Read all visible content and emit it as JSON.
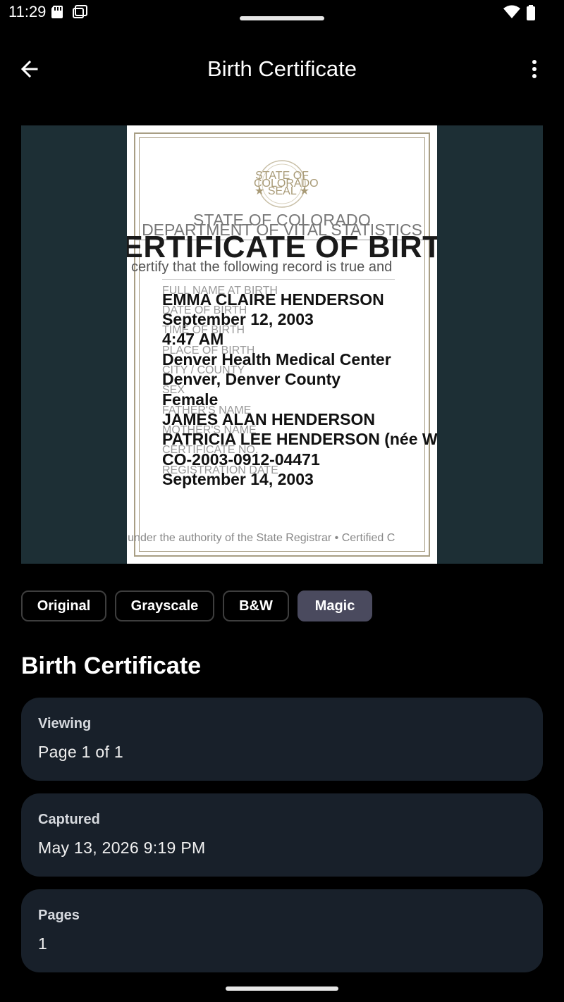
{
  "status_bar": {
    "time": "11:29",
    "icons": [
      "sd-card-icon",
      "screenshot-icon",
      "wifi-icon",
      "battery-icon"
    ]
  },
  "app_bar": {
    "title": "Birth Certificate",
    "back_icon": "arrow-left-icon",
    "menu_icon": "more-vert-icon"
  },
  "preview": {
    "seal_lines": [
      "STATE OF",
      "COLORADO",
      "★ SEAL ★"
    ],
    "state": "STATE OF COLORADO",
    "department": "DEPARTMENT OF VITAL STATISTICS",
    "title": "CERTIFICATE OF BIRTH",
    "certify_text": "certify that the following record is true and",
    "fields": [
      {
        "label": "FULL NAME AT BIRTH",
        "value": "EMMA CLAIRE HENDERSON"
      },
      {
        "label": "DATE OF BIRTH",
        "value": "September 12, 2003"
      },
      {
        "label": "TIME OF BIRTH",
        "value": "4:47 AM"
      },
      {
        "label": "PLACE OF BIRTH",
        "value": "Denver Health Medical Center"
      },
      {
        "label": "CITY / COUNTY",
        "value": "Denver, Denver County"
      },
      {
        "label": "SEX",
        "value": "Female"
      },
      {
        "label": "FATHER'S NAME",
        "value": "JAMES ALAN HENDERSON"
      },
      {
        "label": "MOTHER'S NAME",
        "value": "PATRICIA LEE HENDERSON (née W"
      },
      {
        "label": "CERTIFICATE NO.",
        "value": "CO-2003-0912-04471"
      },
      {
        "label": "REGISTRATION DATE",
        "value": "September 14, 2003"
      }
    ],
    "footer": "ued under the authority of the State Registrar • Certified C"
  },
  "filters": {
    "options": [
      "Original",
      "Grayscale",
      "B&W",
      "Magic"
    ],
    "selected": "Magic"
  },
  "document": {
    "title": "Birth Certificate"
  },
  "info_cards": [
    {
      "label": "Viewing",
      "value": "Page 1 of 1"
    },
    {
      "label": "Captured",
      "value": "May 13, 2026 9:19 PM"
    },
    {
      "label": "Pages",
      "value": "1"
    }
  ],
  "colors": {
    "background": "#000000",
    "preview_bg": "#1d2f35",
    "card_bg": "#18202a",
    "chip_active": "#4a4a5e",
    "seal": "#a89a76"
  }
}
